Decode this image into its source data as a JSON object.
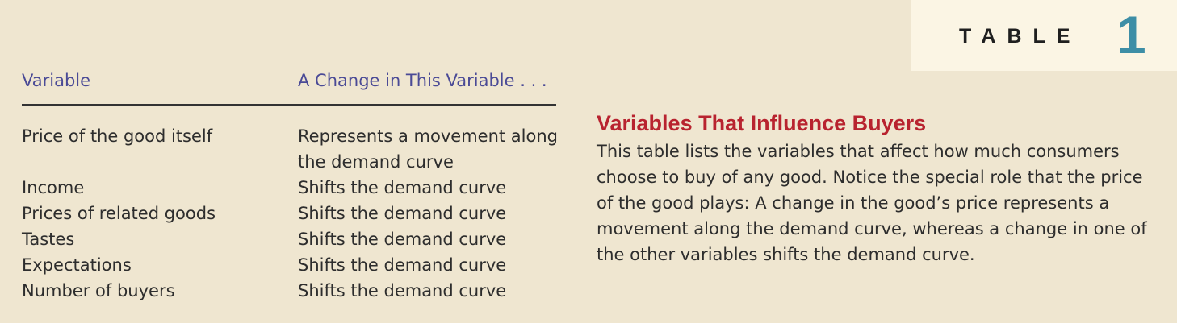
{
  "badge": {
    "word": "TABLE",
    "number": "1"
  },
  "table": {
    "headers": {
      "variable": "Variable",
      "change": "A Change in This Variable . . ."
    },
    "rows": [
      {
        "variable": "Price of the good itself",
        "change": "Represents a movement along the demand curve"
      },
      {
        "variable": "Income",
        "change": "Shifts the demand curve"
      },
      {
        "variable": "Prices of related goods",
        "change": "Shifts the demand curve"
      },
      {
        "variable": "Tastes",
        "change": "Shifts the demand curve"
      },
      {
        "variable": "Expectations",
        "change": "Shifts the demand curve"
      },
      {
        "variable": "Number of buyers",
        "change": "Shifts the demand curve"
      }
    ]
  },
  "caption": {
    "title": "Variables That Influence Buyers",
    "body": "This table lists the variables that affect how much consumers choose to buy of any good. Notice the special role that the price of the good plays: A change in the good’s price represents a movement along the demand curve, whereas a change in one of the other variables shifts the demand curve."
  }
}
